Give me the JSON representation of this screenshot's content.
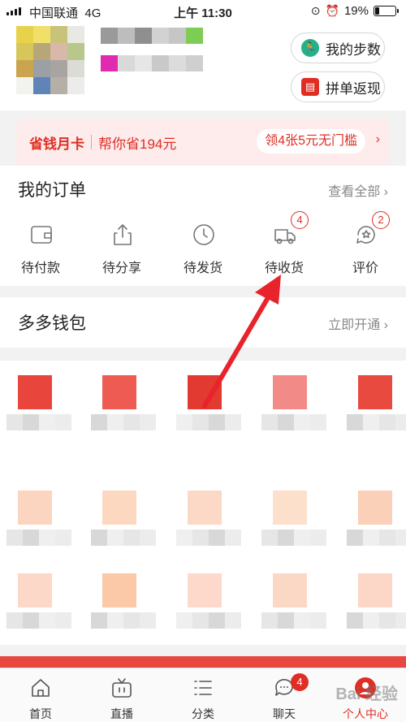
{
  "status_bar": {
    "carrier": "中国联通",
    "network": "4G",
    "time": "上午 11:30",
    "battery": "19%",
    "battery_level": 0.19
  },
  "profile": {
    "steps_button": "我的步数",
    "group_cashback_button": "拼单返现"
  },
  "saver_card": {
    "title": "省钱月卡",
    "subtitle": "帮你省194元",
    "cta": "领4张5元无门槛",
    "arrow": "›"
  },
  "orders": {
    "title": "我的订单",
    "view_all": "查看全部",
    "view_all_arrow": "›",
    "items": [
      {
        "label": "待付款",
        "icon": "wallet-icon",
        "badge": null
      },
      {
        "label": "待分享",
        "icon": "share-icon",
        "badge": null
      },
      {
        "label": "待发货",
        "icon": "clock-icon",
        "badge": null
      },
      {
        "label": "待收货",
        "icon": "truck-icon",
        "badge": "4"
      },
      {
        "label": "评价",
        "icon": "review-icon",
        "badge": "2"
      }
    ]
  },
  "wallet": {
    "title": "多多钱包",
    "action": "立即开通",
    "arrow": "›"
  },
  "bottom_nav": {
    "items": [
      {
        "label": "首页",
        "icon": "home-icon"
      },
      {
        "label": "直播",
        "icon": "tv-icon"
      },
      {
        "label": "分类",
        "icon": "list-icon"
      },
      {
        "label": "聊天",
        "icon": "chat-icon",
        "badge": "4"
      },
      {
        "label": "个人中心",
        "icon": "profile-icon",
        "active": true
      }
    ]
  },
  "colors": {
    "accent": "#e02e24",
    "saver_bg": "#fdeceb",
    "annotation_arrow": "#e8232b"
  },
  "watermark": "Bai 经验"
}
